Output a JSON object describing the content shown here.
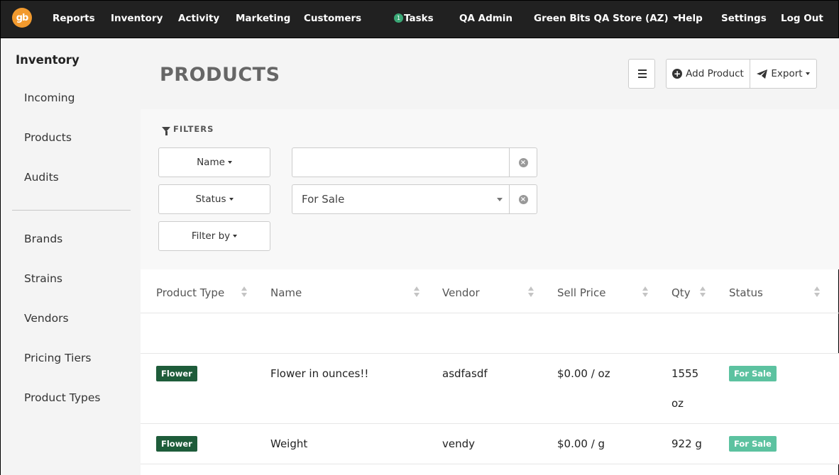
{
  "nav": {
    "logo": "gb",
    "items": [
      "Reports",
      "Inventory",
      "Activity",
      "Marketing",
      "Customers"
    ],
    "tasks_count": "1",
    "tasks_label": "Tasks",
    "user": "QA Admin",
    "store": "Green Bits QA Store (AZ)",
    "help": "Help",
    "settings": "Settings",
    "logout": "Log Out"
  },
  "sidebar": {
    "title": "Inventory",
    "items": [
      "Incoming",
      "Products",
      "Audits",
      "Brands",
      "Strains",
      "Vendors",
      "Pricing Tiers",
      "Product Types"
    ]
  },
  "page": {
    "title": "PRODUCTS",
    "add_product": "Add Product",
    "export": "Export"
  },
  "filters": {
    "label": "FILTERS",
    "name_btn": "Name",
    "status_btn": "Status",
    "filter_by_btn": "Filter by",
    "name_value": "",
    "status_value": "For Sale"
  },
  "table": {
    "headers": [
      "Product Type",
      "Name",
      "Vendor",
      "Sell Price",
      "Qty",
      "Status"
    ],
    "rows": [
      {
        "type": "Flower",
        "name": "Flower in ounces!!",
        "vendor": "asdfasdf",
        "price": "$0.00 / oz",
        "qty": "1555 oz",
        "status": "For Sale"
      },
      {
        "type": "Flower",
        "name": "Weight",
        "vendor": "vendy",
        "price": "$0.00 / g",
        "qty": "922 g",
        "status": "For Sale"
      }
    ]
  },
  "colors": {
    "nav_bg": "#212121",
    "logo": "#f29a2e",
    "type_badge": "#1e5c3a",
    "status_badge": "#5cc2a0"
  }
}
